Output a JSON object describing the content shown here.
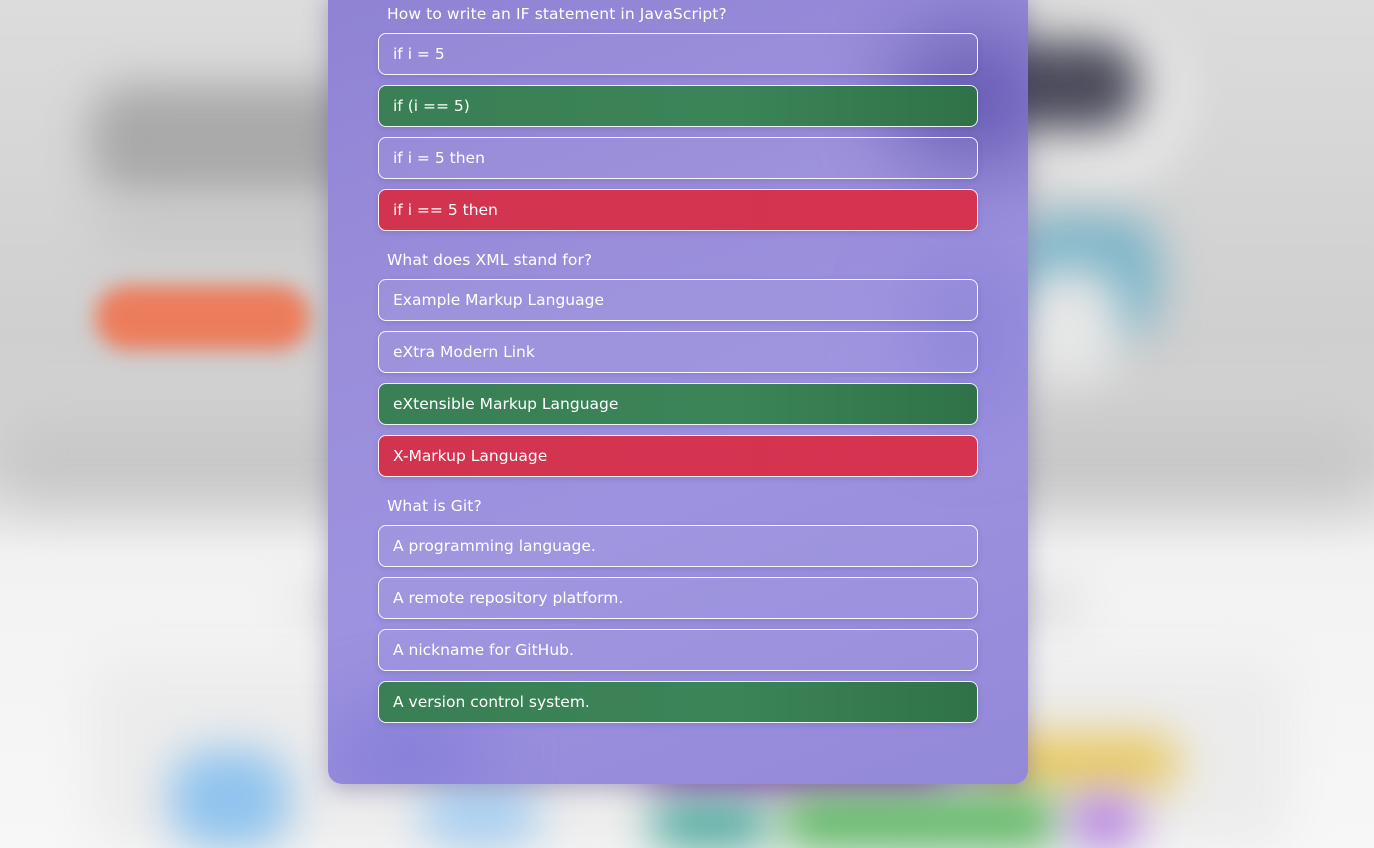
{
  "quiz": {
    "questions": [
      {
        "text": "How to write an IF statement in JavaScript?",
        "options": [
          {
            "label": "if i = 5",
            "state": "neutral"
          },
          {
            "label": "if (i == 5)",
            "state": "correct"
          },
          {
            "label": "if i = 5 then",
            "state": "neutral"
          },
          {
            "label": "if i == 5 then",
            "state": "wrong"
          }
        ]
      },
      {
        "text": "What does XML stand for?",
        "options": [
          {
            "label": "Example Markup Language",
            "state": "neutral"
          },
          {
            "label": "eXtra Modern Link",
            "state": "neutral"
          },
          {
            "label": "eXtensible Markup Language",
            "state": "correct"
          },
          {
            "label": "X-Markup Language",
            "state": "wrong"
          }
        ]
      },
      {
        "text": "What is Git?",
        "options": [
          {
            "label": "A programming language.",
            "state": "neutral"
          },
          {
            "label": "A remote repository platform.",
            "state": "neutral"
          },
          {
            "label": "A nickname for GitHub.",
            "state": "neutral"
          },
          {
            "label": "A version control system.",
            "state": "correct"
          }
        ]
      }
    ]
  },
  "colors": {
    "panel": "#9a8edb",
    "correct": "#3b8458",
    "wrong": "#d6334f",
    "text": "#ffffff"
  }
}
